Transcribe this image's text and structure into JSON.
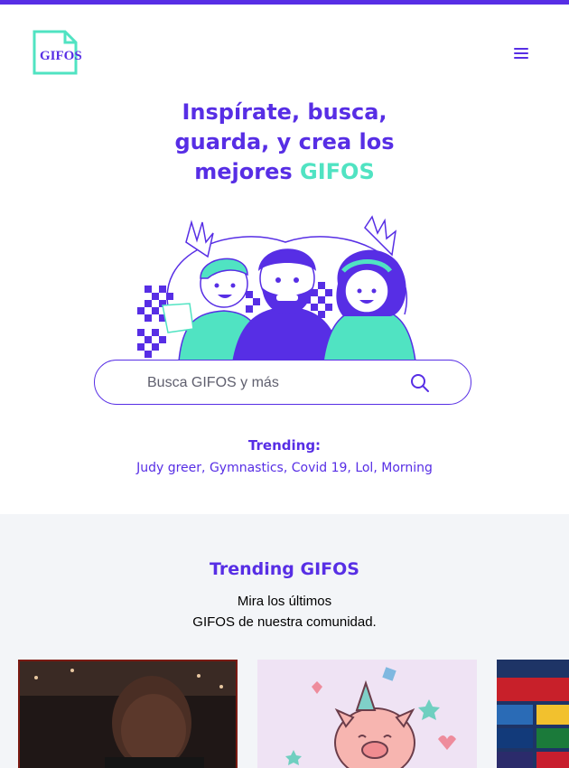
{
  "header": {
    "logo_text": "GIFOS",
    "menu_icon": "hamburger-icon"
  },
  "hero": {
    "headline_line1": "Inspírate, busca,",
    "headline_line2": "guarda, y crea los",
    "headline_line3_prefix": "mejores ",
    "headline_accent": "GIFOS",
    "illustration": "three-friends-waving-illustration"
  },
  "search": {
    "placeholder": "Busca GIFOS y más",
    "icon": "search-icon"
  },
  "trending": {
    "title": "Trending:",
    "terms": [
      "Judy greer",
      "Gymnastics",
      "Covid 19",
      "Lol",
      "Morning"
    ]
  },
  "trending_gifos": {
    "title": "Trending GIFOS",
    "subtitle_line1": "Mira los últimos",
    "subtitle_line2": "GIFOS de nuestra comunidad.",
    "gifs": [
      {
        "subject": "man-in-suit-gif"
      },
      {
        "subject": "party-pig-gif"
      },
      {
        "subject": "sponsor-board-gif"
      }
    ]
  },
  "colors": {
    "primary": "#572EE5",
    "accent": "#50E3C2",
    "section_bg": "#F3F5F8"
  }
}
